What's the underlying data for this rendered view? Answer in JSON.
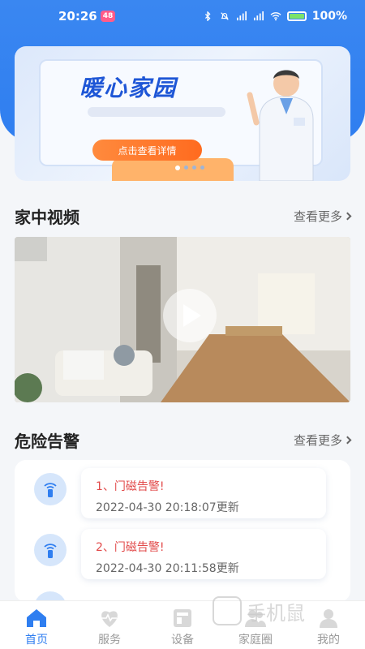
{
  "status_bar": {
    "time": "20:26",
    "badge": "48",
    "battery": "100%"
  },
  "banner": {
    "title": "暖心家园",
    "button_label": "点击查看详情"
  },
  "video_section": {
    "title": "家中视频",
    "more_label": "查看更多"
  },
  "alert_section": {
    "title": "危险告警",
    "more_label": "查看更多",
    "items": [
      {
        "name": "1、门磁告警!",
        "time": "2022-04-30 20:18:07更新"
      },
      {
        "name": "2、门磁告警!",
        "time": "2022-04-30 20:11:58更新"
      }
    ]
  },
  "tabbar": {
    "items": [
      {
        "label": "首页",
        "icon": "home-icon",
        "active": true
      },
      {
        "label": "服务",
        "icon": "heart-pulse-icon",
        "active": false
      },
      {
        "label": "设备",
        "icon": "device-icon",
        "active": false
      },
      {
        "label": "家庭圈",
        "icon": "family-icon",
        "active": false
      },
      {
        "label": "我的",
        "icon": "profile-icon",
        "active": false
      }
    ]
  },
  "watermark": {
    "text": "手机鼠"
  },
  "colors": {
    "primary": "#2f7ef0",
    "alert": "#e24a4a",
    "banner_button": "#ff7a2a"
  }
}
